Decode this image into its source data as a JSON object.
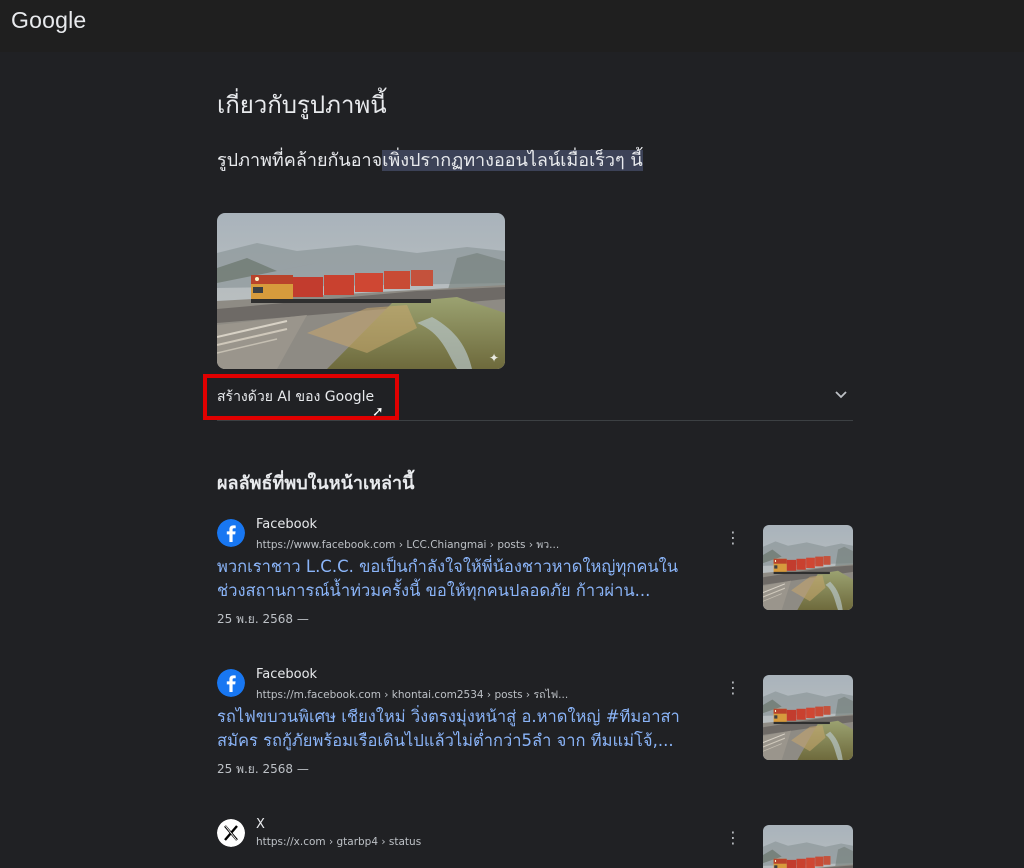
{
  "header": {
    "logo": "Google"
  },
  "about": {
    "title": "เกี่ยวกับรูปภาพนี้",
    "subtitle_plain": "รูปภาพที่คล้ายกันอาจ",
    "subtitle_highlight": "เพิ่งปรากฏทางออนไลน์เมื่อเร็วๆ นี้",
    "ai_label": "สร้างด้วย AI ของ Google",
    "expand_icon": "chevron-down-icon"
  },
  "results": {
    "heading": "ผลลัพธ์ที่พบในหน้าเหล่านี้",
    "items": [
      {
        "site": "Facebook",
        "icon": "facebook-icon",
        "url": "https://www.facebook.com › LCC.Chiangmai › posts › พว...",
        "title_line1": "พวกเราชาว L.C.C. ขอเป็นกำลังใจให้พี่น้องชาวหาดใหญ่ทุกคนใน",
        "title_line2": "ช่วงสถานการณ์น้ำท่วมครั้งนี้ ขอให้ทุกคนปลอดภัย ก้าวผ่าน...",
        "date": "25 พ.ย. 2568 —"
      },
      {
        "site": "Facebook",
        "icon": "facebook-icon",
        "url": "https://m.facebook.com › khontai.com2534 › posts › รถไฟ...",
        "title_line1": "รถไฟขบวนพิเศษ เชียงใหม่ วิ่งตรงมุ่งหน้าสู่ อ.หาดใหญ่ #ทีมอาสา",
        "title_line2": "สมัคร รถกู้ภัยพร้อมเรือเดินไปแล้วไม่ต่ำกว่า5ลำ จาก ทีมแม่โจ้,...",
        "date": "25 พ.ย. 2568 —"
      },
      {
        "site": "X",
        "icon": "x-icon",
        "url": "https://x.com › gtarbp4 › status",
        "title_line1": "",
        "title_line2": "",
        "date": ""
      }
    ]
  },
  "colors": {
    "background": "#202124",
    "link": "#8ab4f8",
    "annotation": "#e00000"
  }
}
